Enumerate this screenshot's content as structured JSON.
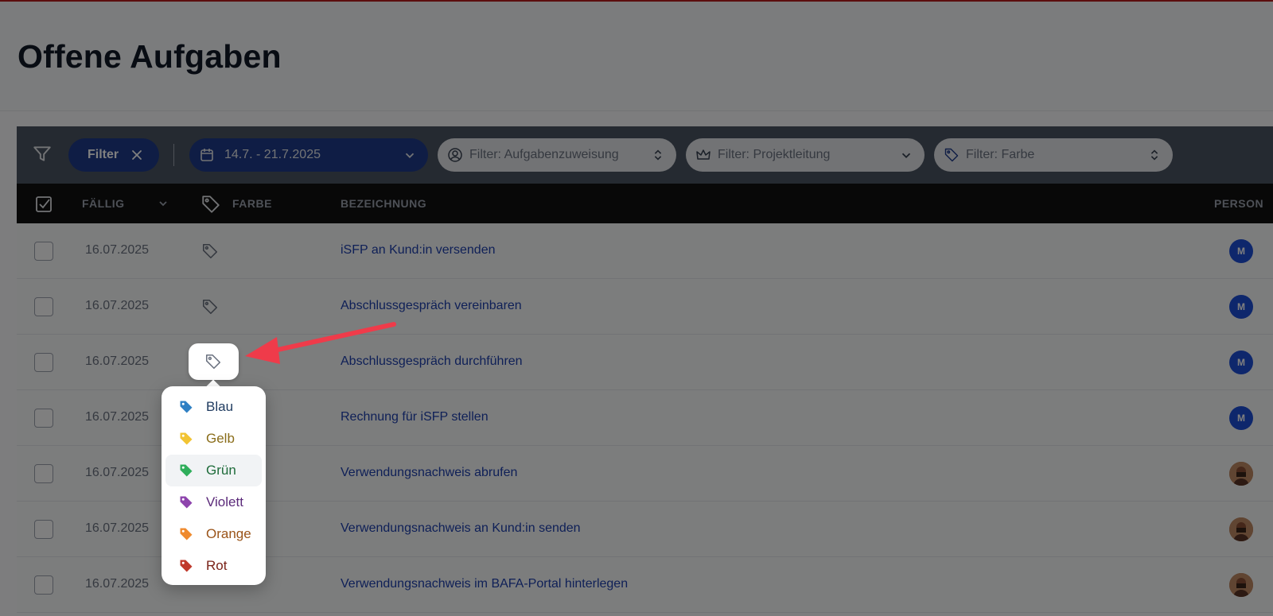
{
  "page": {
    "title": "Offene Aufgaben"
  },
  "filterbar": {
    "filter_label": "Filter",
    "date_range": "14.7. - 21.7.2025",
    "assign_placeholder": "Filter: Aufgabenzuweisung",
    "lead_placeholder": "Filter: Projektleitung",
    "color_placeholder": "Filter: Farbe"
  },
  "table": {
    "headers": {
      "due": "FÄLLIG",
      "color": "FARBE",
      "name": "BEZEICHNUNG",
      "person": "PERSON"
    },
    "rows": [
      {
        "due": "16.07.2025",
        "title": "iSFP an Kund:in versenden",
        "person": "M",
        "avatar_type": "initial"
      },
      {
        "due": "16.07.2025",
        "title": "Abschlussgespräch vereinbaren",
        "person": "M",
        "avatar_type": "initial"
      },
      {
        "due": "16.07.2025",
        "title": "Abschlussgespräch durchführen",
        "person": "M",
        "avatar_type": "initial"
      },
      {
        "due": "16.07.2025",
        "title": "Rechnung für iSFP stellen",
        "person": "M",
        "avatar_type": "initial"
      },
      {
        "due": "16.07.2025",
        "title": "Verwendungsnachweis abrufen",
        "person": "",
        "avatar_type": "photo"
      },
      {
        "due": "16.07.2025",
        "title": "Verwendungsnachweis an Kund:in senden",
        "person": "",
        "avatar_type": "photo"
      },
      {
        "due": "16.07.2025",
        "title": "Verwendungsnachweis im BAFA-Portal hinterlegen",
        "person": "",
        "avatar_type": "photo"
      }
    ]
  },
  "color_menu": {
    "items": [
      {
        "label": "Blau",
        "icon": "tag-icon",
        "color": "#2f80c4",
        "text_color": "#1e3a5f"
      },
      {
        "label": "Gelb",
        "icon": "tag-icon",
        "color": "#f2c433",
        "text_color": "#8a6d1a"
      },
      {
        "label": "Grün",
        "icon": "tag-icon",
        "color": "#2fae5b",
        "text_color": "#1e6b3a",
        "highlighted": true
      },
      {
        "label": "Violett",
        "icon": "tag-icon",
        "color": "#8e44ad",
        "text_color": "#5b2a7a"
      },
      {
        "label": "Orange",
        "icon": "tag-icon",
        "color": "#ef8a2e",
        "text_color": "#9a5318"
      },
      {
        "label": "Rot",
        "icon": "tag-icon",
        "color": "#c0392b",
        "text_color": "#7a2218"
      }
    ]
  },
  "colors": {
    "accent": "#1e3a8a",
    "link": "#1e40af",
    "annotation_arrow": "#ef3b4a"
  }
}
